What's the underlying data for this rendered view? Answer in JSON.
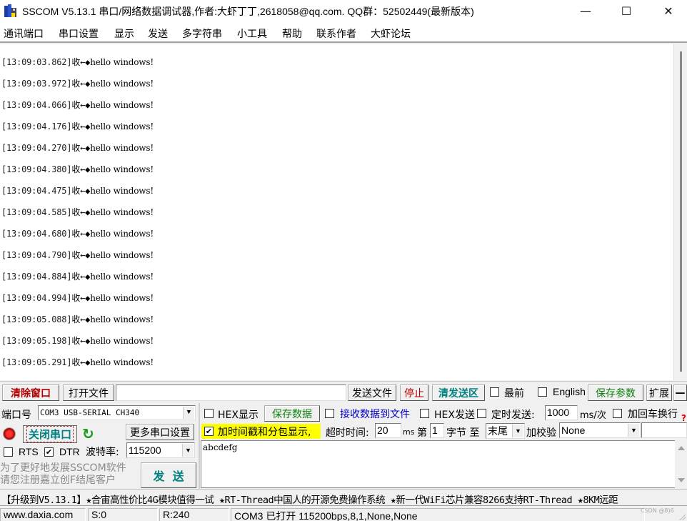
{
  "window": {
    "title": "SSCOM V5.13.1 串口/网络数据调试器,作者:大虾丁丁,2618058@qq.com. QQ群：52502449(最新版本)",
    "minimize_glyph": "—",
    "maximize_glyph": "☐",
    "close_glyph": "✕"
  },
  "menu": {
    "items": [
      "通讯端口",
      "串口设置",
      "显示",
      "发送",
      "多字符串",
      "小工具",
      "帮助",
      "联系作者",
      "大虾论坛"
    ]
  },
  "receive": {
    "lines": [
      {
        "time": "[13:09:03.862]",
        "dir": "收←◆",
        "text": "hello windows!"
      },
      {
        "time": "[13:09:03.972]",
        "dir": "收←◆",
        "text": "hello windows!"
      },
      {
        "time": "[13:09:04.066]",
        "dir": "收←◆",
        "text": "hello windows!"
      },
      {
        "time": "[13:09:04.176]",
        "dir": "收←◆",
        "text": "hello windows!"
      },
      {
        "time": "[13:09:04.270]",
        "dir": "收←◆",
        "text": "hello windows!"
      },
      {
        "time": "[13:09:04.380]",
        "dir": "收←◆",
        "text": "hello windows!"
      },
      {
        "time": "[13:09:04.475]",
        "dir": "收←◆",
        "text": "hello windows!"
      },
      {
        "time": "[13:09:04.585]",
        "dir": "收←◆",
        "text": "hello windows!"
      },
      {
        "time": "[13:09:04.680]",
        "dir": "收←◆",
        "text": "hello windows!"
      },
      {
        "time": "[13:09:04.790]",
        "dir": "收←◆",
        "text": "hello windows!"
      },
      {
        "time": "[13:09:04.884]",
        "dir": "收←◆",
        "text": "hello windows!"
      },
      {
        "time": "[13:09:04.994]",
        "dir": "收←◆",
        "text": "hello windows!"
      },
      {
        "time": "[13:09:05.088]",
        "dir": "收←◆",
        "text": "hello windows!"
      },
      {
        "time": "[13:09:05.198]",
        "dir": "收←◆",
        "text": "hello windows!"
      },
      {
        "time": "[13:09:05.291]",
        "dir": "收←◆",
        "text": "hello windows!"
      }
    ]
  },
  "toolbar": {
    "clear_window": "清除窗口",
    "open_file": "打开文件",
    "file_path": "",
    "send_file": "发送文件",
    "stop": "停止",
    "clear_send": "清发送区",
    "topmost_label": "最前",
    "topmost_checked": false,
    "english_label": "English",
    "english_checked": false,
    "save_params": "保存参数",
    "expand": "扩展",
    "collapse": "—"
  },
  "port": {
    "port_label": "端口号",
    "port_value": "COM3 USB-SERIAL CH340",
    "close_port": "关闭串口",
    "more_settings": "更多串口设置",
    "rts_label": "RTS",
    "rts_checked": false,
    "dtr_label": "DTR",
    "dtr_checked": true,
    "baud_label": "波特率:",
    "baud_value": "115200",
    "promo_line1": "为了更好地发展SSCOM软件",
    "promo_line2": "请您注册嘉立创F结尾客户",
    "send_button": "发  送"
  },
  "options": {
    "hex_display_label": "HEX显示",
    "hex_display_checked": false,
    "save_data": "保存数据",
    "recv_to_file_label": "接收数据到文件",
    "recv_to_file_checked": false,
    "hex_send_label": "HEX发送",
    "hex_send_checked": false,
    "timed_send_label": "定时发送:",
    "timed_send_checked": false,
    "interval_value": "1000",
    "interval_unit": "ms/次",
    "add_crlf_label": "加回车换行",
    "add_crlf_checked": false,
    "timestamp_label": "加时间戳和分包显示,",
    "timestamp_checked": true,
    "timeout_label": "超时时间:",
    "timeout_value": "20",
    "timeout_unit": "ms",
    "byte_from_label": "第",
    "byte_from_value": "1",
    "byte_unit_label": "字节 至",
    "byte_to_value": "末尾",
    "checksum_label": "加校验",
    "checksum_value": "None",
    "checksum_extra": "",
    "help_glyph": "?"
  },
  "send": {
    "text": "abcdefg"
  },
  "marquee": {
    "text": "【升级到V5.13.1】★合宙高性价比4G模块值得一试 ★RT-Thread中国人的开源免费操作系统 ★新一代WiFi芯片兼容8266支持RT-Thread ★8KM远距"
  },
  "statusbar": {
    "website": "www.daxia.com",
    "sent": "S:0",
    "received": "R:240",
    "port_status": "COM3 已打开  115200bps,8,1,None,None",
    "watermark": "CSDN @8)6"
  },
  "colors": {
    "clear_window": "#b00000",
    "stop": "#b00000",
    "clear_send": "#00807f",
    "save_green": "#108010",
    "recv_file_blue": "#0000c0",
    "close_port": "#008080",
    "timestamp_bg": "#ffff00",
    "refresh_green": "#1a9a1a"
  }
}
